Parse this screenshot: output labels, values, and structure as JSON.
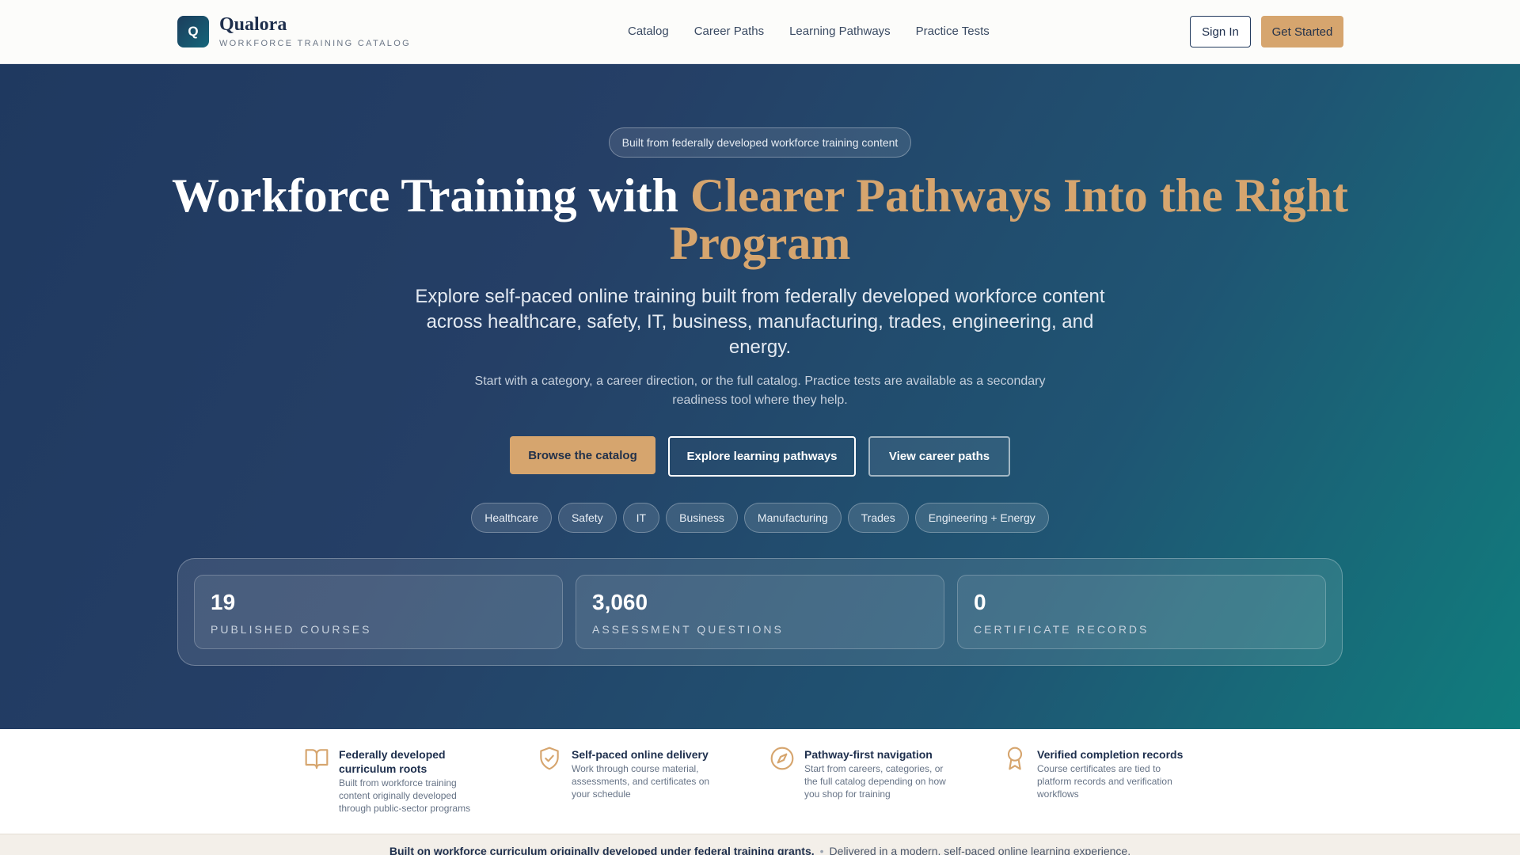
{
  "header": {
    "logo_letter": "Q",
    "brand_name": "Qualora",
    "brand_tagline": "WORKFORCE TRAINING CATALOG",
    "nav": [
      "Catalog",
      "Career Paths",
      "Learning Pathways",
      "Practice Tests"
    ],
    "sign_in": "Sign In",
    "get_started": "Get Started"
  },
  "hero": {
    "badge": "Built from federally developed workforce training content",
    "title_plain": "Workforce Training with ",
    "title_accent": "Clearer Pathways Into the Right Program",
    "subtitle": "Explore self-paced online training built from federally developed workforce content across healthcare, safety, IT, business, manufacturing, trades, engineering, and energy.",
    "description": "Start with a category, a career direction, or the full catalog. Practice tests are available as a secondary readiness tool where they help.",
    "cta_primary": "Browse the catalog",
    "cta_pathways": "Explore learning pathways",
    "cta_careers": "View career paths",
    "categories": [
      "Healthcare",
      "Safety",
      "IT",
      "Business",
      "Manufacturing",
      "Trades",
      "Engineering + Energy"
    ]
  },
  "stats": [
    {
      "value": "19",
      "label": "PUBLISHED COURSES"
    },
    {
      "value": "3,060",
      "label": "ASSESSMENT QUESTIONS"
    },
    {
      "value": "0",
      "label": "CERTIFICATE RECORDS"
    }
  ],
  "features": [
    {
      "icon": "open-book-icon",
      "title": "Federally developed curriculum roots",
      "desc": "Built from workforce training content originally developed through public-sector programs"
    },
    {
      "icon": "shield-check-icon",
      "title": "Self-paced online delivery",
      "desc": "Work through course material, assessments, and certificates on your schedule"
    },
    {
      "icon": "compass-icon",
      "title": "Pathway-first navigation",
      "desc": "Start from careers, categories, or the full catalog depending on how you shop for training"
    },
    {
      "icon": "award-ribbon-icon",
      "title": "Verified completion records",
      "desc": "Course certificates are tied to platform records and verification workflows"
    }
  ],
  "footer_strip": {
    "strong": "Built on workforce curriculum originally developed under federal training grants.",
    "dot": "•",
    "text": "Delivered in a modern, self-paced online learning experience."
  },
  "colors": {
    "accent": "#d6a56e",
    "navy": "#1e2f4d",
    "hero_start": "#1f3960",
    "hero_end": "#107d7d"
  }
}
